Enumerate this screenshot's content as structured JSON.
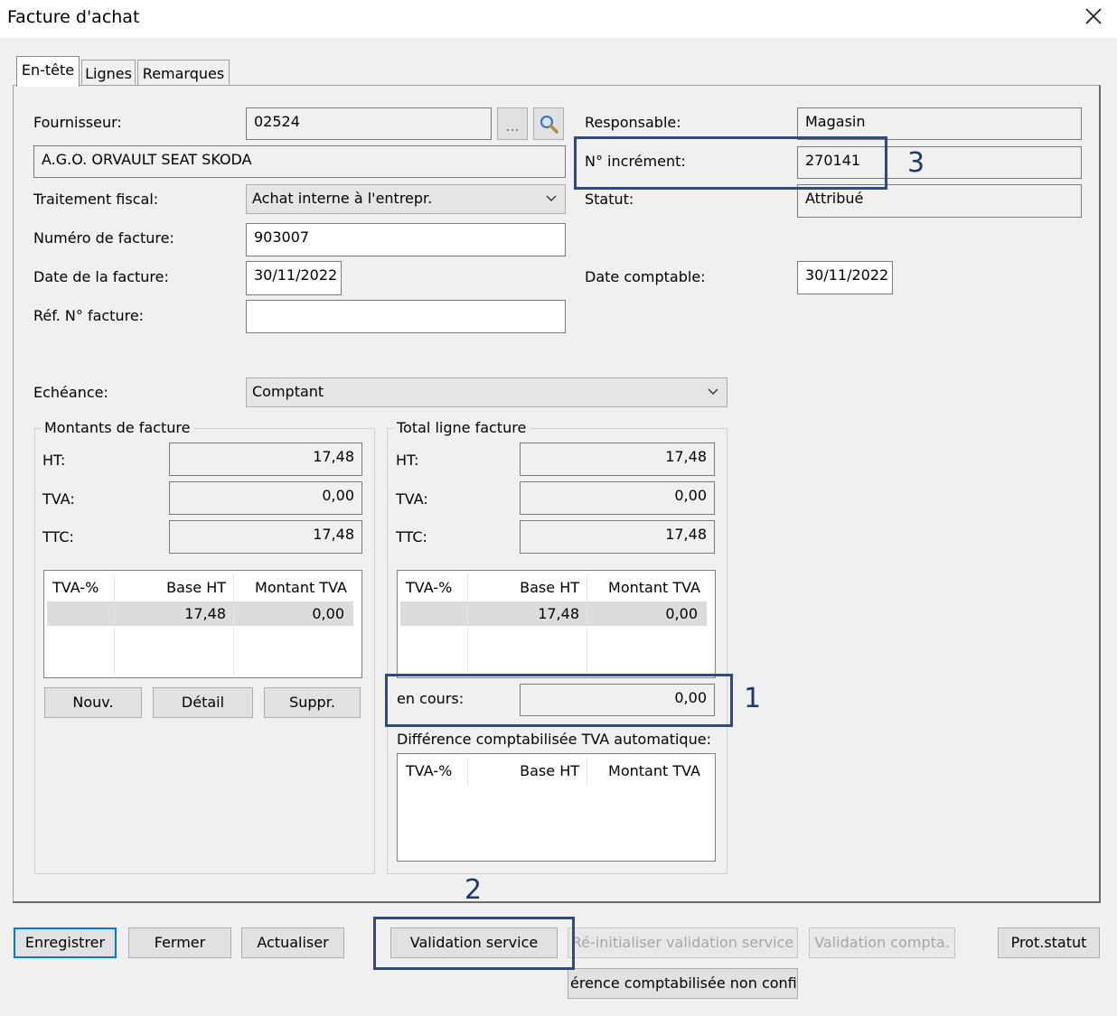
{
  "window": {
    "title": "Facture d'achat",
    "close_icon": "close-icon"
  },
  "tabs": [
    {
      "label": "En-tête"
    },
    {
      "label": "Lignes"
    },
    {
      "label": "Remarques"
    }
  ],
  "form": {
    "fournisseur": {
      "label": "Fournisseur:",
      "value": "02524",
      "browse_label": "..."
    },
    "fournisseur_nom": "A.G.O. ORVAULT SEAT SKODA",
    "traitement_fiscal": {
      "label": "Traitement fiscal:",
      "value": "Achat interne à l'entrepr."
    },
    "numero_facture": {
      "label": "Numéro de facture:",
      "value": "903007"
    },
    "date_facture": {
      "label": "Date de la facture:",
      "value": "30/11/2022"
    },
    "ref_facture": {
      "label": "Réf. N° facture:",
      "value": ""
    },
    "responsable": {
      "label": "Responsable:",
      "value": "Magasin"
    },
    "no_increment": {
      "label": "N° incrément:",
      "value": "270141"
    },
    "statut": {
      "label": "Statut:",
      "value": "Attribué"
    },
    "date_comptable": {
      "label": "Date comptable:",
      "value": "30/11/2022"
    },
    "echeance": {
      "label": "Echéance:",
      "value": "Comptant"
    }
  },
  "montants": {
    "title": "Montants de facture",
    "ht": {
      "label": "HT:",
      "value": "17,48"
    },
    "tva": {
      "label": "TVA:",
      "value": "0,00"
    },
    "ttc": {
      "label": "TTC:",
      "value": "17,48"
    },
    "grid": {
      "headers": [
        "TVA-%",
        "Base HT",
        "Montant TVA"
      ],
      "row": [
        "",
        "17,48",
        "0,00"
      ]
    },
    "buttons": {
      "nouv": "Nouv.",
      "detail": "Détail",
      "suppr": "Suppr."
    }
  },
  "total_ligne": {
    "title": "Total ligne facture",
    "ht": {
      "label": "HT:",
      "value": "17,48"
    },
    "tva": {
      "label": "TVA:",
      "value": "0,00"
    },
    "ttc": {
      "label": "TTC:",
      "value": "17,48"
    },
    "grid": {
      "headers": [
        "TVA-%",
        "Base HT",
        "Montant TVA"
      ],
      "row": [
        "",
        "17,48",
        "0,00"
      ]
    },
    "en_cours": {
      "label": "en cours:",
      "value": "0,00"
    },
    "difference_title": "Différence comptabilisée TVA automatique:",
    "diff_grid": {
      "headers": [
        "TVA-%",
        "Base HT",
        "Montant TVA"
      ]
    }
  },
  "buttons": {
    "enregistrer": "Enregistrer",
    "fermer": "Fermer",
    "actualiser": "Actualiser",
    "validation_service": "Validation service",
    "reinit_validation": "Ré-initialiser validation service",
    "validation_compta": "Validation compta.",
    "prot_statut": "Prot.statut",
    "difference_non_confirm": "érence comptabilisée non confirn"
  },
  "annotations": {
    "one": "1",
    "two": "2",
    "three": "3"
  },
  "colors": {
    "annotation": "#2f4b7c",
    "focus": "#0078d7"
  }
}
